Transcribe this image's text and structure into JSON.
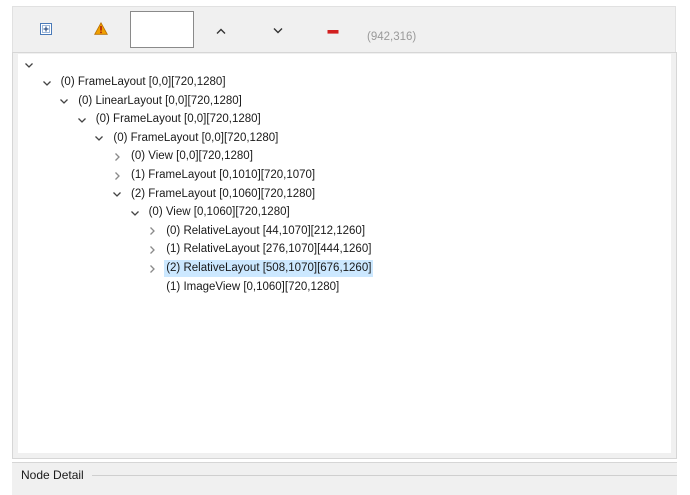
{
  "toolbar": {
    "coords_readout": "(942,316)",
    "buttons": [
      {
        "name": "expand-all-button",
        "icon": "expand-box-icon"
      },
      {
        "name": "warning-button",
        "icon": "warning-icon"
      },
      {
        "name": "move-up-button",
        "icon": "chevron-up-icon"
      },
      {
        "name": "move-down-button",
        "icon": "chevron-down-icon"
      },
      {
        "name": "remove-button",
        "icon": "minus-red-icon"
      }
    ],
    "colors": {
      "warning_fill": "#f0a000",
      "remove_red": "#d21f1f",
      "expand_blue": "#4a7ab8"
    }
  },
  "tree": {
    "root_label": "",
    "nodes": [
      {
        "label": "(0) FrameLayout [0,0][720,1280]",
        "depth": 1,
        "state": "expanded"
      },
      {
        "label": "(0) LinearLayout [0,0][720,1280]",
        "depth": 2,
        "state": "expanded"
      },
      {
        "label": "(0) FrameLayout [0,0][720,1280]",
        "depth": 3,
        "state": "expanded"
      },
      {
        "label": "(0) FrameLayout [0,0][720,1280]",
        "depth": 4,
        "state": "expanded"
      },
      {
        "label": "(0) View [0,0][720,1280]",
        "depth": 5,
        "state": "collapsed"
      },
      {
        "label": "(1) FrameLayout [0,1010][720,1070]",
        "depth": 5,
        "state": "collapsed"
      },
      {
        "label": "(2) FrameLayout [0,1060][720,1280]",
        "depth": 5,
        "state": "expanded"
      },
      {
        "label": "(0) View [0,1060][720,1280]",
        "depth": 6,
        "state": "expanded"
      },
      {
        "label": "(0) RelativeLayout [44,1070][212,1260]",
        "depth": 7,
        "state": "collapsed"
      },
      {
        "label": "(1) RelativeLayout [276,1070][444,1260]",
        "depth": 7,
        "state": "collapsed"
      },
      {
        "label": "(2) RelativeLayout [508,1070][676,1260]",
        "depth": 7,
        "state": "collapsed",
        "selected": true
      },
      {
        "label": "(1) ImageView [0,1060][720,1280]",
        "depth": 7,
        "state": "leaf"
      }
    ]
  },
  "detail": {
    "title": "Node Detail"
  }
}
